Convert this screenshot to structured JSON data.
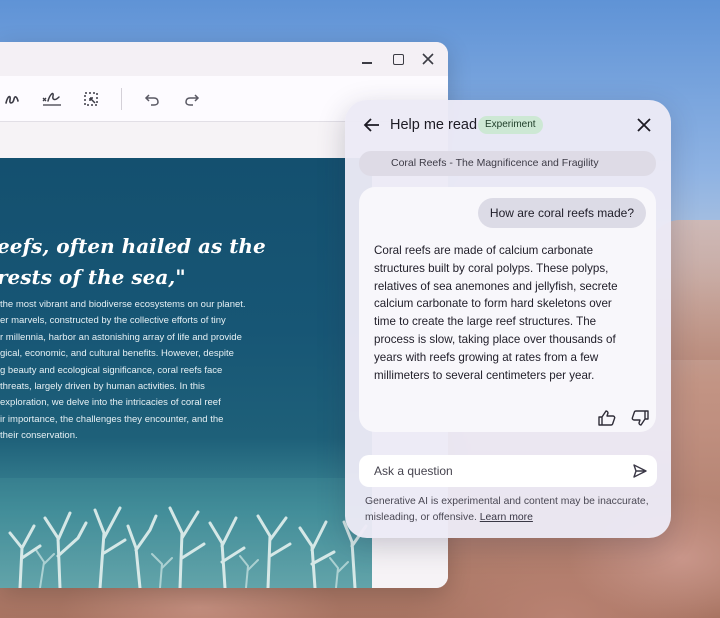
{
  "window": {
    "controls": [
      "minimize",
      "maximize",
      "close"
    ]
  },
  "toolbar": {
    "icons": [
      "draw-icon",
      "signature-icon",
      "select-region-icon",
      "undo-icon",
      "redo-icon"
    ]
  },
  "document": {
    "heading_lines": [
      "eefs, often hailed as the",
      "rests of the sea,\""
    ],
    "body_lines": [
      "the most vibrant and biodiverse ecosystems on our planet.",
      "er marvels, constructed by the collective efforts of tiny",
      "r millennia, harbor an astonishing array of life and provide",
      "gical, economic, and cultural benefits. However, despite",
      "g beauty and ecological significance, coral reefs face",
      "threats, largely driven by human activities. In this",
      "exploration, we delve into the intricacies of coral reef",
      "ir importance, the challenges they encounter, and the",
      "their conservation."
    ]
  },
  "panel": {
    "title": "Help me read",
    "badge": "Experiment",
    "doc_title": "Coral Reefs - The Magnificence and Fragility",
    "user_question": "How are coral reefs made?",
    "answer_lines": [
      "Coral reefs are made of calcium carbonate",
      "structures built by coral polyps. These polyps,",
      "relatives of sea anemones and jellyfish, secrete",
      "calcium carbonate to form hard skeletons over",
      "time to create the large reef structures. The",
      "process is slow, taking place over thousands of",
      "years with reefs growing at rates from a few",
      "millimeters to several centimeters per year."
    ],
    "ask_placeholder": "Ask a question",
    "disclaimer_line1": "Generative AI is experimental and content may be inaccurate,",
    "disclaimer_line2": "misleading, or offensive.",
    "learn_more": "Learn more"
  },
  "colors": {
    "badge_bg": "#cde8d4",
    "doc_panel": "#175675",
    "panel_bg": "#eceaf6"
  }
}
